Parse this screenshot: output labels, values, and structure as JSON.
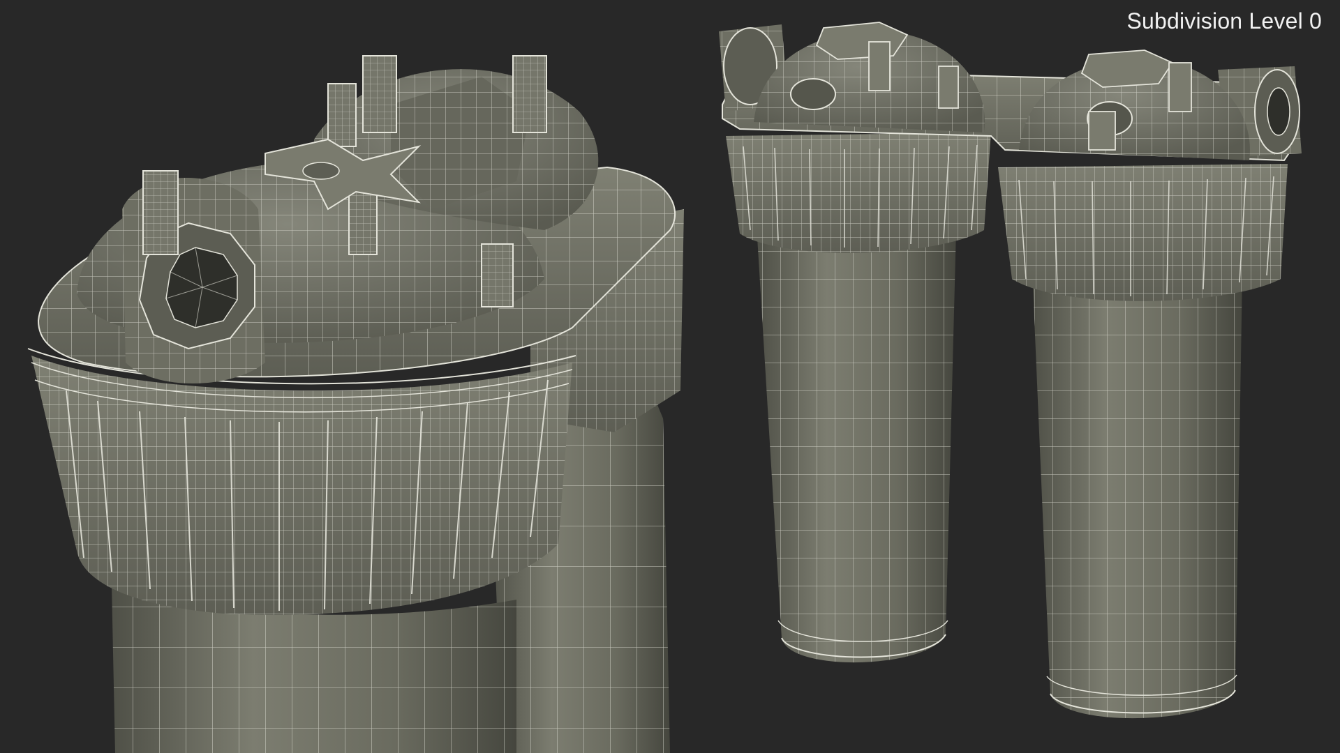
{
  "viewport": {
    "label": "Subdivision Level 0",
    "background_color": "#282828"
  },
  "colors": {
    "surface": "#6f7064",
    "surface_dark": "#55564c",
    "surface_light": "#8a8b7e",
    "wire": "#e4e4da",
    "label": "#f2f2f2"
  }
}
